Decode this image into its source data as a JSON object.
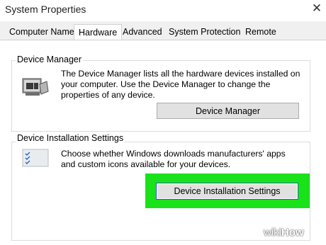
{
  "window": {
    "title": "System Properties",
    "close_glyph": "✕"
  },
  "tabs": [
    {
      "label": "Computer Name",
      "active": false
    },
    {
      "label": "Hardware",
      "active": true
    },
    {
      "label": "Advanced",
      "active": false
    },
    {
      "label": "System Protection",
      "active": false
    },
    {
      "label": "Remote",
      "active": false
    }
  ],
  "device_manager": {
    "heading": "Device Manager",
    "description": "The Device Manager lists all the hardware devices installed on your computer. Use the Device Manager to change the properties of any device.",
    "button_label": "Device Manager",
    "icon": "device-manager-icon"
  },
  "device_installation": {
    "heading": "Device Installation Settings",
    "description": "Choose whether Windows downloads manufacturers' apps and custom icons available for your devices.",
    "button_label": "Device Installation Settings",
    "icon": "checklist-icon"
  },
  "highlight_color": "#1ae21a",
  "watermark": {
    "wiki": "wiki",
    "how": "How"
  }
}
